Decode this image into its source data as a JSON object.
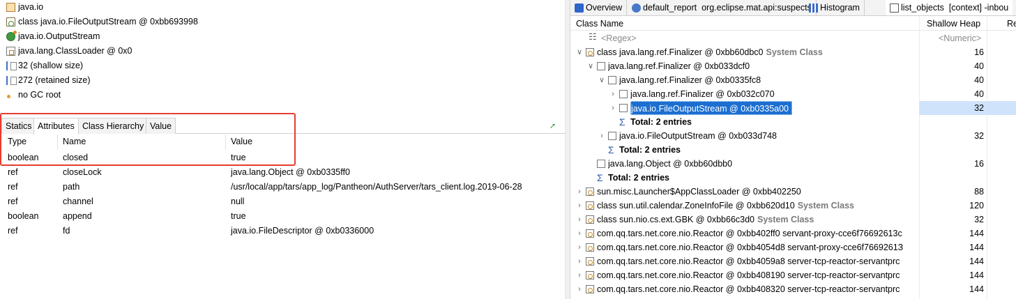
{
  "left_panel": {
    "info": [
      {
        "icon": "package-icon",
        "text": "java.io"
      },
      {
        "icon": "class-icon",
        "text": "class java.io.FileOutputStream @ 0xbb693998"
      },
      {
        "icon": "superclass-icon",
        "text": "java.io.OutputStream"
      },
      {
        "icon": "classloader-icon",
        "text": "java.lang.ClassLoader @ 0x0"
      },
      {
        "icon": "size-icon",
        "text": "32 (shallow size)"
      },
      {
        "icon": "size-icon",
        "text": "272 (retained size)"
      },
      {
        "icon": "gc-root-icon",
        "text": "no GC root"
      }
    ],
    "tabs": [
      "Statics",
      "Attributes",
      "Class Hierarchy",
      "Value"
    ],
    "active_tab": "Attributes",
    "columns": [
      "Type",
      "Name",
      "Value"
    ],
    "rows": [
      {
        "type": "boolean",
        "name": "closed",
        "value": "true"
      },
      {
        "type": "ref",
        "name": "closeLock",
        "value": "java.lang.Object @ 0xb0335ff0"
      },
      {
        "type": "ref",
        "name": "path",
        "value": "/usr/local/app/tars/app_log/Pantheon/AuthServer/tars_client.log.2019-06-28"
      },
      {
        "type": "ref",
        "name": "channel",
        "value": "null"
      },
      {
        "type": "boolean",
        "name": "append",
        "value": "true"
      },
      {
        "type": "ref",
        "name": "fd",
        "value": "java.io.FileDescriptor @ 0xb0336000"
      }
    ],
    "highlight_color": "#e43d30"
  },
  "right_panel": {
    "tabs": [
      {
        "icon": "overview-icon",
        "label": "Overview"
      },
      {
        "icon": "report-icon",
        "label": "default_report  org.eclipse.mat.api:suspects"
      },
      {
        "icon": "histogram-icon",
        "label": "Histogram"
      },
      {
        "icon": "list-icon",
        "label": "list_objects  [context] -inbou"
      }
    ],
    "columns": {
      "class_name": "Class Name",
      "shallow_heap": "Shallow Heap",
      "retained": "Re"
    },
    "filters": {
      "class_name": "<Regex>",
      "shallow_heap": "<Numeric>"
    },
    "selection_color": "#1c6fd1",
    "rows": [
      {
        "indent": 0,
        "arrow": "down",
        "icon": "class-obj",
        "name": "class java.lang.ref.Finalizer @ 0xbb60dbc0",
        "tag": "System Class",
        "heap": "16"
      },
      {
        "indent": 1,
        "arrow": "down",
        "icon": "doc",
        "name": "java.lang.ref.Finalizer @ 0xb033dcf0",
        "tag": "",
        "heap": "40"
      },
      {
        "indent": 2,
        "arrow": "down",
        "icon": "doc",
        "name": "java.lang.ref.Finalizer @ 0xb0335fc8",
        "tag": "",
        "heap": "40"
      },
      {
        "indent": 3,
        "arrow": "right",
        "icon": "doc",
        "name": "java.lang.ref.Finalizer @ 0xb032c070",
        "tag": "",
        "heap": "40"
      },
      {
        "indent": 3,
        "arrow": "right",
        "icon": "doc",
        "name": "java.io.FileOutputStream @ 0xb0335a00",
        "tag": "",
        "heap": "32",
        "selected": true
      },
      {
        "indent": 3,
        "arrow": "",
        "icon": "sum",
        "name": "Total: 2 entries",
        "tag": "",
        "heap": "",
        "bold": true
      },
      {
        "indent": 2,
        "arrow": "right",
        "icon": "doc",
        "name": "java.io.FileOutputStream @ 0xb033d748",
        "tag": "",
        "heap": "32"
      },
      {
        "indent": 2,
        "arrow": "",
        "icon": "sum",
        "name": "Total: 2 entries",
        "tag": "",
        "heap": "",
        "bold": true
      },
      {
        "indent": 1,
        "arrow": "",
        "icon": "doc",
        "name": "java.lang.Object @ 0xbb60dbb0",
        "tag": "",
        "heap": "16"
      },
      {
        "indent": 1,
        "arrow": "",
        "icon": "sum",
        "name": "Total: 2 entries",
        "tag": "",
        "heap": "",
        "bold": true
      },
      {
        "indent": 0,
        "arrow": "right",
        "icon": "class-obj",
        "name": "sun.misc.Launcher$AppClassLoader @ 0xbb402250",
        "tag": "",
        "heap": "88"
      },
      {
        "indent": 0,
        "arrow": "right",
        "icon": "class-obj",
        "name": "class sun.util.calendar.ZoneInfoFile @ 0xbb620d10",
        "tag": "System Class",
        "heap": "120"
      },
      {
        "indent": 0,
        "arrow": "right",
        "icon": "class-obj",
        "name": "class sun.nio.cs.ext.GBK @ 0xbb66c3d0",
        "tag": "System Class",
        "heap": "32"
      },
      {
        "indent": 0,
        "arrow": "right",
        "icon": "class-obj",
        "name": "com.qq.tars.net.core.nio.Reactor @ 0xbb402ff0  servant-proxy-cce6f76692613c",
        "tag": "",
        "heap": "144"
      },
      {
        "indent": 0,
        "arrow": "right",
        "icon": "class-obj",
        "name": "com.qq.tars.net.core.nio.Reactor @ 0xbb4054d8  servant-proxy-cce6f7669261З",
        "tag": "",
        "heap": "144"
      },
      {
        "indent": 0,
        "arrow": "right",
        "icon": "class-obj",
        "name": "com.qq.tars.net.core.nio.Reactor @ 0xbb4059a8  server-tcp-reactor-servantprc",
        "tag": "",
        "heap": "144"
      },
      {
        "indent": 0,
        "arrow": "right",
        "icon": "class-obj",
        "name": "com.qq.tars.net.core.nio.Reactor @ 0xbb408190  server-tcp-reactor-servantprc",
        "tag": "",
        "heap": "144"
      },
      {
        "indent": 0,
        "arrow": "right",
        "icon": "class-obj",
        "name": "com.qq.tars.net.core.nio.Reactor @ 0xbb408320  server-tcp-reactor-servantprc",
        "tag": "",
        "heap": "144"
      }
    ]
  }
}
